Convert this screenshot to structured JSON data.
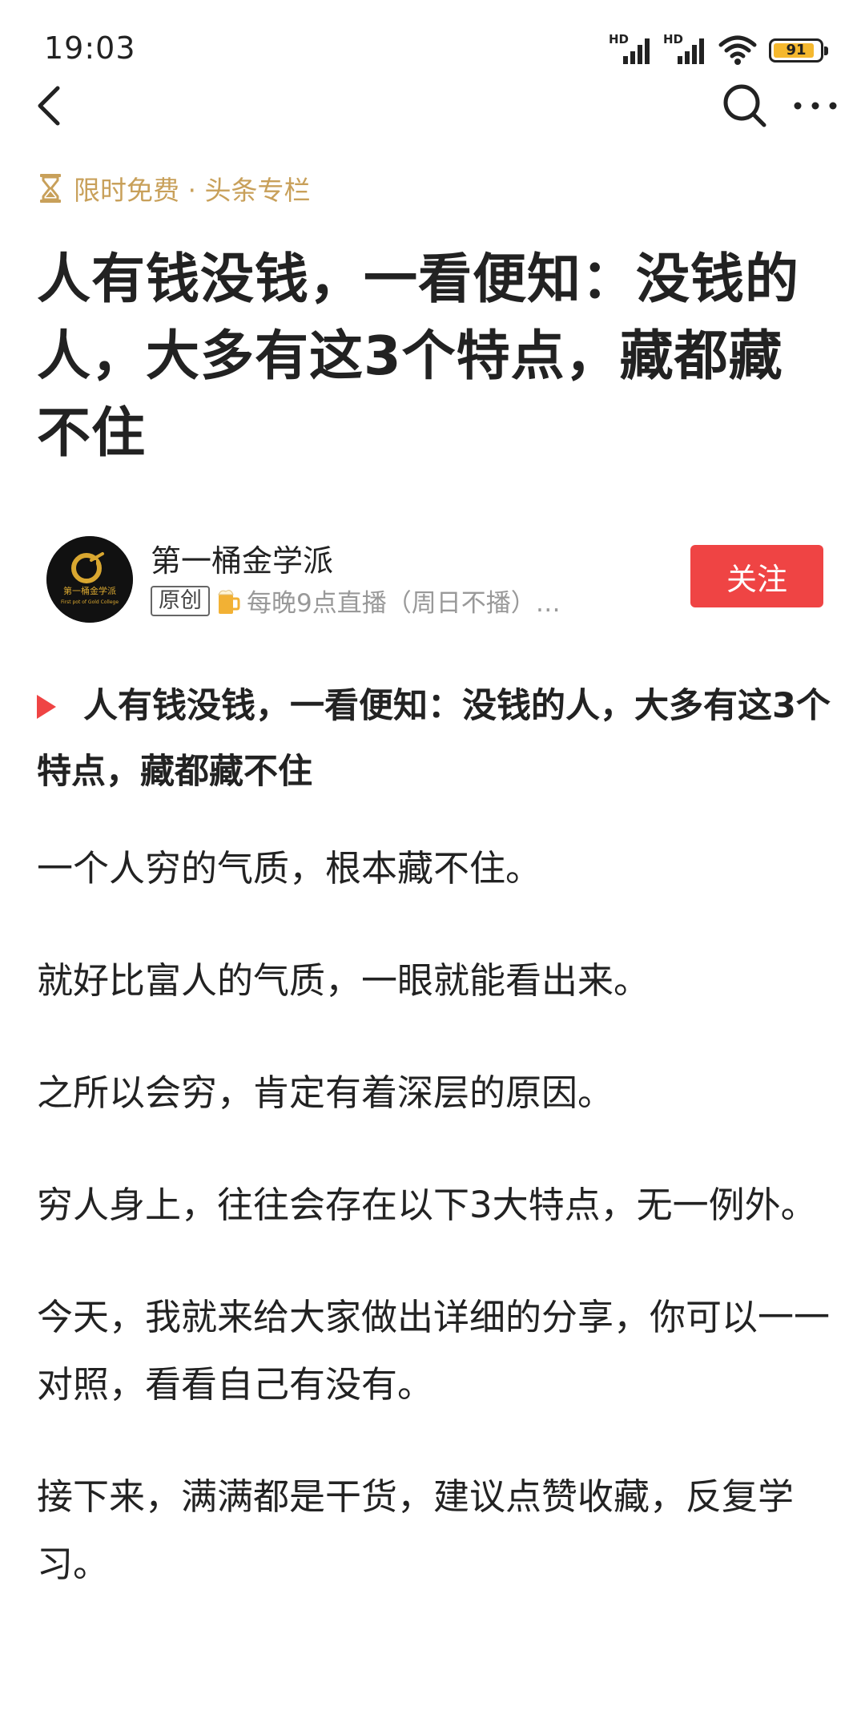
{
  "status_bar": {
    "time": "19:03",
    "signal_1_label": "HD",
    "signal_2_label": "HD",
    "battery": "91"
  },
  "nav": {
    "back_icon": "chevron-left-icon",
    "search_icon": "search-icon",
    "more_icon": "more-dots-icon"
  },
  "column_tag": {
    "icon": "hourglass-icon",
    "text": "限时免费 · 头条专栏",
    "color": "#c8a05a"
  },
  "article": {
    "title": "人有钱没钱，一看便知：没钱的人，大多有这3个特点，藏都藏不住",
    "lead": "人有钱没钱，一看便知：没钱的人，大多有这3个特点，藏都藏不住",
    "paragraphs": [
      "一个人穷的气质，根本藏不住。",
      "就好比富人的气质，一眼就能看出来。",
      "之所以会穷，肯定有着深层的原因。",
      "穷人身上，往往会存在以下3大特点，无一例外。",
      "今天，我就来给大家做出详细的分享，你可以一一对照，看看自己有没有。",
      "接下来，满满都是干货，建议点赞收藏，反复学习。"
    ]
  },
  "author": {
    "name": "第一桶金学派",
    "badge": "原创",
    "description": "每晚9点直播（周日不播）…",
    "follow_label": "关注",
    "avatar_logo_text": "第一桶金学派",
    "avatar_logo_subtext": "First pot of Gold College"
  },
  "colors": {
    "accent_red": "#ef4444",
    "tag_gold": "#c8a05a",
    "text_primary": "#222222",
    "text_secondary": "#999999"
  }
}
